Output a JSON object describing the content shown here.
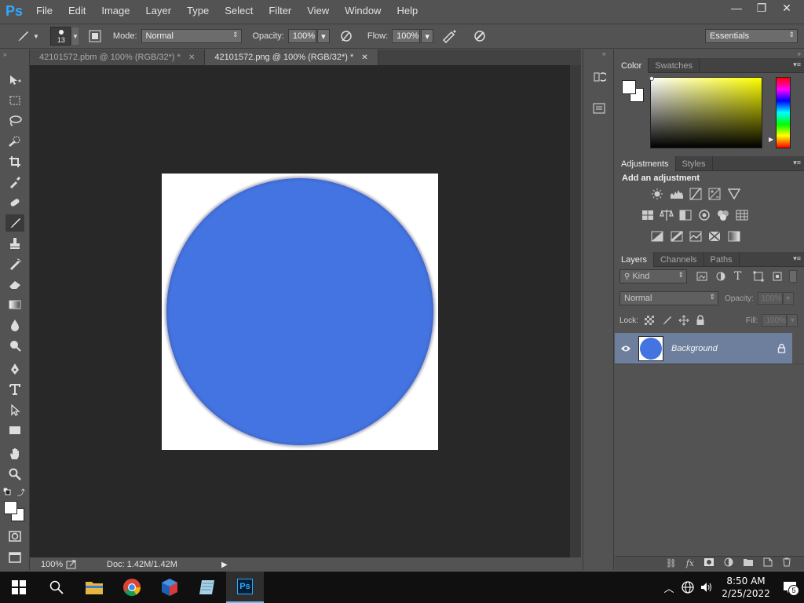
{
  "app": {
    "logo": "Ps"
  },
  "menu": [
    "File",
    "Edit",
    "Image",
    "Layer",
    "Type",
    "Select",
    "Filter",
    "View",
    "Window",
    "Help"
  ],
  "window_controls": {
    "minimize": "—",
    "restore": "❐",
    "close": "✕"
  },
  "options": {
    "brush_size": "13",
    "mode_label": "Mode:",
    "mode_value": "Normal",
    "opacity_label": "Opacity:",
    "opacity_value": "100%",
    "flow_label": "Flow:",
    "flow_value": "100%",
    "workspace": "Essentials"
  },
  "tabs": [
    {
      "label": "42101572.pbm @ 100% (RGB/32*) *",
      "active": false
    },
    {
      "label": "42101572.png @ 100% (RGB/32*) *",
      "active": true
    }
  ],
  "canvas": {
    "background": "#282828",
    "image_bg": "#ffffff",
    "circle_color": "#4474e1"
  },
  "status": {
    "zoom": "100%",
    "doc": "Doc: 1.42M/1.42M"
  },
  "color_panel": {
    "tabs": [
      "Color",
      "Swatches"
    ]
  },
  "adjustments_panel": {
    "tabs": [
      "Adjustments",
      "Styles"
    ],
    "title": "Add an adjustment"
  },
  "layers_panel": {
    "tabs": [
      "Layers",
      "Channels",
      "Paths"
    ],
    "filter": "Kind",
    "blend_mode": "Normal",
    "opacity_label": "Opacity:",
    "opacity_value": "100%",
    "lock_label": "Lock:",
    "fill_label": "Fill:",
    "fill_value": "100%",
    "layer_name": "Background"
  },
  "taskbar": {
    "time": "8:50 AM",
    "date": "2/25/2022",
    "notification_count": "5"
  }
}
